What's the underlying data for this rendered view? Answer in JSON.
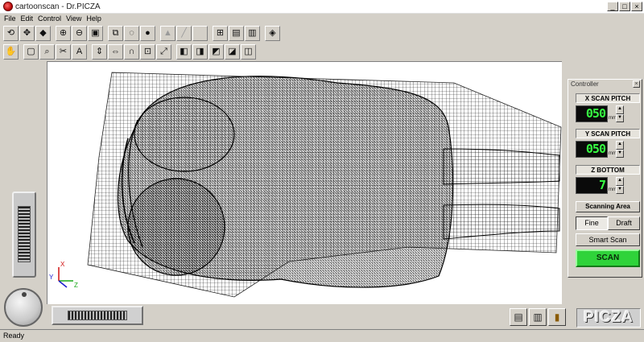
{
  "window": {
    "title": "cartoonscan - Dr.PICZA",
    "minimize": "_",
    "maximize": "□",
    "close": "×"
  },
  "menu": [
    "File",
    "Edit",
    "Control",
    "View",
    "Help"
  ],
  "toolbar1": [
    {
      "name": "pointer-tool",
      "glyph": "⟲"
    },
    {
      "name": "move-tool",
      "glyph": "✥"
    },
    {
      "name": "color-tool",
      "glyph": "◆"
    },
    {
      "name": "zoom-in-tool",
      "glyph": "⊕"
    },
    {
      "name": "zoom-out-tool",
      "glyph": "⊖"
    },
    {
      "name": "fit-tool",
      "glyph": "▣"
    },
    {
      "name": "copy-tool",
      "glyph": "⧉"
    },
    {
      "name": "lasso-tool",
      "glyph": "◌"
    },
    {
      "name": "render-tool",
      "glyph": "●"
    },
    {
      "name": "fill-tool",
      "glyph": "▲"
    },
    {
      "name": "brush-tool",
      "glyph": "╱"
    },
    {
      "name": "blank-tool",
      "glyph": ""
    },
    {
      "name": "layers-tool",
      "glyph": "⊞"
    },
    {
      "name": "clipboard-tool",
      "glyph": "▤"
    },
    {
      "name": "print-tool",
      "glyph": "▥"
    },
    {
      "name": "sticker-tool",
      "glyph": "◈"
    }
  ],
  "toolbar2": [
    {
      "name": "hand-tool",
      "glyph": "✋"
    },
    {
      "name": "rect-select-tool",
      "glyph": "▢"
    },
    {
      "name": "zoom-select-tool",
      "glyph": "⌕"
    },
    {
      "name": "cut-select-tool",
      "glyph": "✂"
    },
    {
      "name": "abc-tool",
      "glyph": "A"
    },
    {
      "name": "flip-v-tool",
      "glyph": "⇕"
    },
    {
      "name": "flip-h-tool",
      "glyph": "⇔"
    },
    {
      "name": "arch-tool",
      "glyph": "∩"
    },
    {
      "name": "grid-tool",
      "glyph": "⊡"
    },
    {
      "name": "resize-tool",
      "glyph": "⤢"
    },
    {
      "name": "box-front-tool",
      "glyph": "◧"
    },
    {
      "name": "box-side-tool",
      "glyph": "◨"
    },
    {
      "name": "box-top-tool",
      "glyph": "◩"
    },
    {
      "name": "box-iso-tool",
      "glyph": "◪"
    },
    {
      "name": "box-back-tool",
      "glyph": "◫"
    }
  ],
  "controller": {
    "title": "Controller",
    "close": "×",
    "x_pitch": {
      "label": "X SCAN PITCH",
      "value": "050",
      "unit": "mm"
    },
    "y_pitch": {
      "label": "Y SCAN PITCH",
      "value": "050",
      "unit": "mm"
    },
    "z_bottom": {
      "label": "Z BOTTOM",
      "value": "7",
      "unit": "mm"
    },
    "scanning_area": "Scanning Area",
    "fine": "Fine",
    "draft": "Draft",
    "smart_scan": "Smart Scan",
    "scan": "SCAN",
    "scan_color": "#2fd33a",
    "lcd_color": "#37ff42"
  },
  "axes": {
    "x": "X",
    "y": "Y",
    "z": "Z"
  },
  "bottom_buttons": [
    "printer-icon",
    "print-preview-icon",
    "exit-door-icon"
  ],
  "logo": "PICZA",
  "status": "Ready"
}
